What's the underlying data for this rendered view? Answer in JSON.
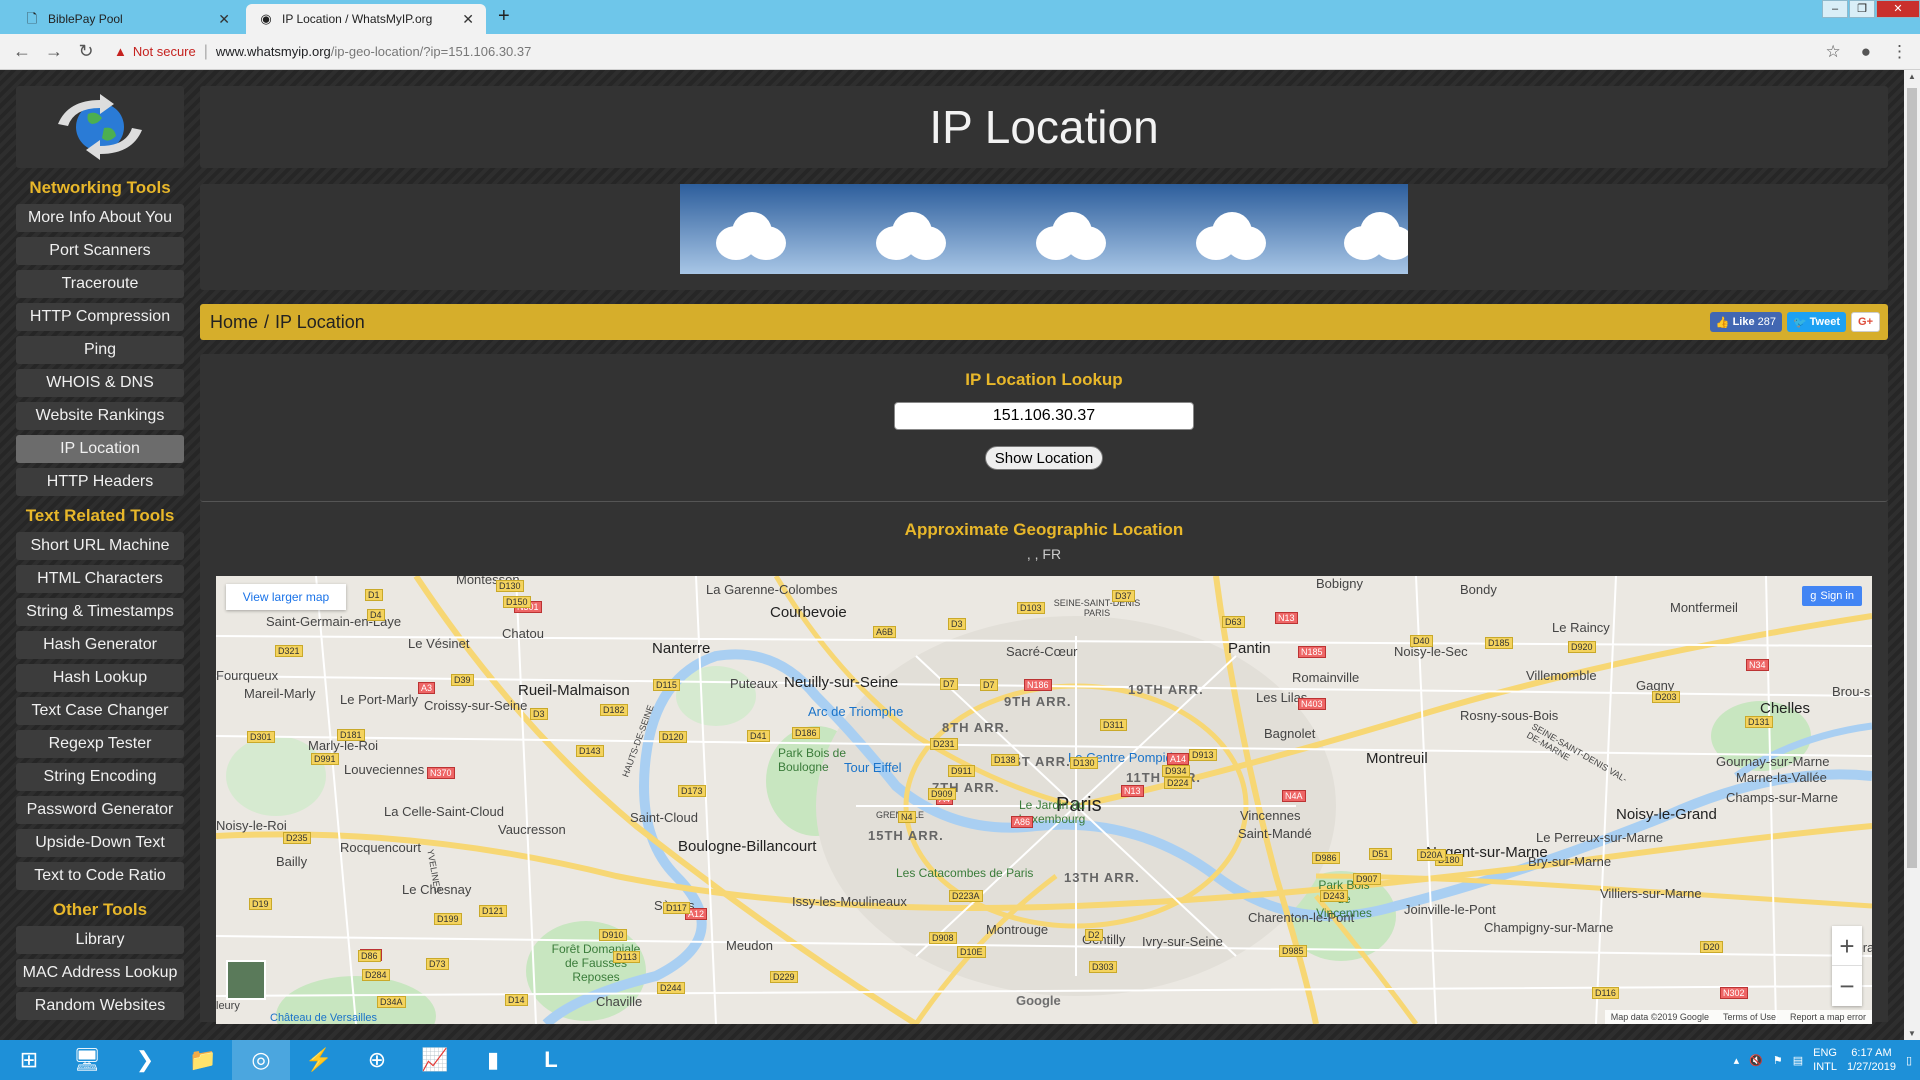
{
  "browser": {
    "tabs": [
      {
        "title": "BiblePay Pool",
        "icon": "page-icon",
        "active": false
      },
      {
        "title": "IP Location / WhatsMyIP.org",
        "icon": "globe-icon",
        "active": true
      }
    ],
    "new_tab": "+",
    "security": "Not secure",
    "url_domain": "www.whatsmyip.org",
    "url_path": "/ip-geo-location/?ip=151.106.30.37"
  },
  "sidebar": {
    "sections": [
      {
        "title": "Networking Tools",
        "items": [
          "More Info About You",
          "Port Scanners",
          "Traceroute",
          "HTTP Compression",
          "Ping",
          "WHOIS & DNS",
          "Website Rankings",
          "IP Location",
          "HTTP Headers"
        ]
      },
      {
        "title": "Text Related Tools",
        "items": [
          "Short URL Machine",
          "HTML Characters",
          "String & Timestamps",
          "Hash Generator",
          "Hash Lookup",
          "Text Case Changer",
          "Regexp Tester",
          "String Encoding",
          "Password Generator",
          "Upside-Down Text",
          "Text to Code Ratio"
        ]
      },
      {
        "title": "Other Tools",
        "items": [
          "Library",
          "MAC Address Lookup",
          "Random Websites"
        ]
      }
    ],
    "active_item": "IP Location"
  },
  "page": {
    "title": "IP Location",
    "breadcrumb": {
      "home": "Home",
      "separator": "/",
      "current": "IP Location"
    },
    "social": {
      "like_label": "Like",
      "like_count": "287",
      "tweet_label": "Tweet",
      "gplus_label": "G+"
    }
  },
  "lookup": {
    "title": "IP Location Lookup",
    "ip_value": "151.106.30.37",
    "button_label": "Show Location"
  },
  "geo": {
    "title": "Approximate Geographic Location",
    "location_text": ", , FR"
  },
  "map": {
    "view_larger": "View larger map",
    "sign_in": "Sign in",
    "zoom_in": "+",
    "zoom_out": "−",
    "google": "Google",
    "attribution": [
      "Map data ©2019 Google",
      "Terms of Use",
      "Report a map error"
    ],
    "labels": {
      "paris": "Paris",
      "nanterre": "Nanterre",
      "courbevoie": "Courbevoie",
      "la_garenne": "La Garenne-Colombes",
      "neuilly": "Neuilly-sur-Seine",
      "puteaux": "Puteaux",
      "rueil": "Rueil-Malmaison",
      "boulogne": "Boulogne-Billancourt",
      "saint_cloud": "Saint-Cloud",
      "issy": "Issy-les-Moulineaux",
      "vincennes": "Vincennes",
      "montreuil": "Montreuil",
      "pantin": "Pantin",
      "bagnolet": "Bagnolet",
      "nogent": "Nogent-sur-Marne",
      "noisy_le_grand": "Noisy-le-Grand",
      "champigny": "Champigny-sur-Marne",
      "chelles": "Chelles",
      "bobigny": "Bobigny",
      "bondy": "Bondy",
      "montfermeil": "Montfermeil",
      "le_raincy": "Le Raincy",
      "villemomble": "Villemomble",
      "gagny": "Gagny",
      "rosny": "Rosny-sous-Bois",
      "noisy_le_sec": "Noisy-le-Sec",
      "romainville": "Romainville",
      "les_lilas": "Les Lilas",
      "saint_germain": "Saint-Germain-en-Laye",
      "chatou": "Chatou",
      "le_vesinet": "Le Vésinet",
      "croissy": "Croissy-sur-Seine",
      "le_port_marly": "Le Port-Marly",
      "mareil": "Mareil-Marly",
      "fourqueux": "Fourqueux",
      "marly": "Marly-le-Roi",
      "louveciennes": "Louveciennes",
      "la_celle": "La Celle-Saint-Cloud",
      "vaucresson": "Vaucresson",
      "rocquencourt": "Rocquencourt",
      "bailly": "Bailly",
      "noisy_le_roi": "Noisy-le-Roi",
      "le_chesnay": "Le Chesnay",
      "sevres": "Sèvres",
      "meudon": "Meudon",
      "chaville": "Chaville",
      "montrouge": "Montrouge",
      "gentilly": "Gentilly",
      "ivry": "Ivry-sur-Seine",
      "charenton": "Charenton-le-Pont",
      "saint_mande": "Saint-Mandé",
      "joinville": "Joinville-le-Pont",
      "le_perreux": "Le Perreux-sur-Marne",
      "bry": "Bry-sur-Marne",
      "villiers": "Villiers-sur-Marne",
      "gournay": "Gournay-sur-Marne",
      "marne_la_vallee": "Marne-la-Vallée",
      "champs": "Champs-sur-Marne",
      "brou": "Brou-s",
      "emera": "Emera",
      "montesson": "Montesson",
      "sacre_coeur": "Sacré-Cœur",
      "arc": "Arc de Triomphe",
      "tour_eiffel": "Tour Eiffel",
      "pompidou": "Le Centre Pompidou",
      "luxembourg": "Le Jardin du Luxembourg",
      "catacombes": "Les Catacombes de Paris",
      "chateau": "Château de Versailles",
      "foret": "Forêt Domaniale de Fausses Reposes",
      "park_boulogne": "Park Bois de Boulogne",
      "park_vincennes": "Park Bois de Vincennes",
      "grenelle": "GRENELLE",
      "seine_st_denis": "SEINE-SAINT-DENIS PARIS",
      "val_de_marne": "SEINE-SAINT-DENIS VAL-DE-MARNE",
      "hauts_de_seine": "HAUTS-DE-SEINE",
      "yvelines": "YVELINES",
      "fleury": "leury",
      "arr_1": "1ST ARR.",
      "arr_7": "7TH ARR.",
      "arr_8": "8TH ARR.",
      "arr_9": "9TH ARR.",
      "arr_11": "11TH ARR.",
      "arr_13": "13TH ARR.",
      "arr_15": "15TH ARR.",
      "arr_19": "19TH ARR."
    },
    "roads": [
      "A86",
      "A3",
      "A4",
      "A13",
      "A14",
      "A12",
      "N13",
      "N186",
      "N185",
      "N13",
      "N301",
      "N302",
      "N370",
      "N34",
      "N4",
      "N403",
      "D14",
      "D7",
      "D311",
      "D121",
      "D186",
      "D284",
      "D113",
      "D7",
      "D913",
      "D180",
      "D39",
      "D3",
      "D991",
      "D986",
      "D131",
      "D909",
      "D908",
      "D911",
      "D115",
      "D40",
      "D117",
      "D116",
      "D20",
      "D20A",
      "D37",
      "D41",
      "D143",
      "D243",
      "D244",
      "D301",
      "D934",
      "D34A",
      "D10E",
      "D224",
      "D199",
      "D203",
      "D321",
      "D907",
      "D985",
      "D910",
      "D150",
      "D1",
      "D2",
      "D920",
      "D103",
      "D173",
      "D181",
      "D182",
      "D185",
      "D130",
      "D63",
      "A6B",
      "D138",
      "D19",
      "D223A",
      "D229",
      "D51",
      "D120",
      "D86",
      "D4",
      "D3",
      "D235",
      "D231",
      "D303",
      "D130",
      "D73",
      "N4A"
    ],
    "road_red": [
      "N301",
      "N302",
      "N370",
      "N34",
      "N13",
      "N186",
      "N185",
      "N403",
      "A86",
      "A3",
      "A4",
      "A13",
      "A14",
      "A12",
      "N4A"
    ]
  },
  "taskbar": {
    "items": [
      "start-icon",
      "explorer-icon",
      "powershell-icon",
      "folder-icon",
      "chrome-icon",
      "bolt-icon",
      "globe-app-icon",
      "chart-icon",
      "terminal-icon",
      "l-app-icon"
    ],
    "lang_top": "ENG",
    "lang_bottom": "INTL",
    "time": "6:17 AM",
    "date": "1/27/2019"
  },
  "colors": {
    "accent": "#e8b72a",
    "crumb_bar": "#d6ae2b",
    "tab_bar": "#6ec6ea",
    "taskbar": "#1e90d8"
  }
}
